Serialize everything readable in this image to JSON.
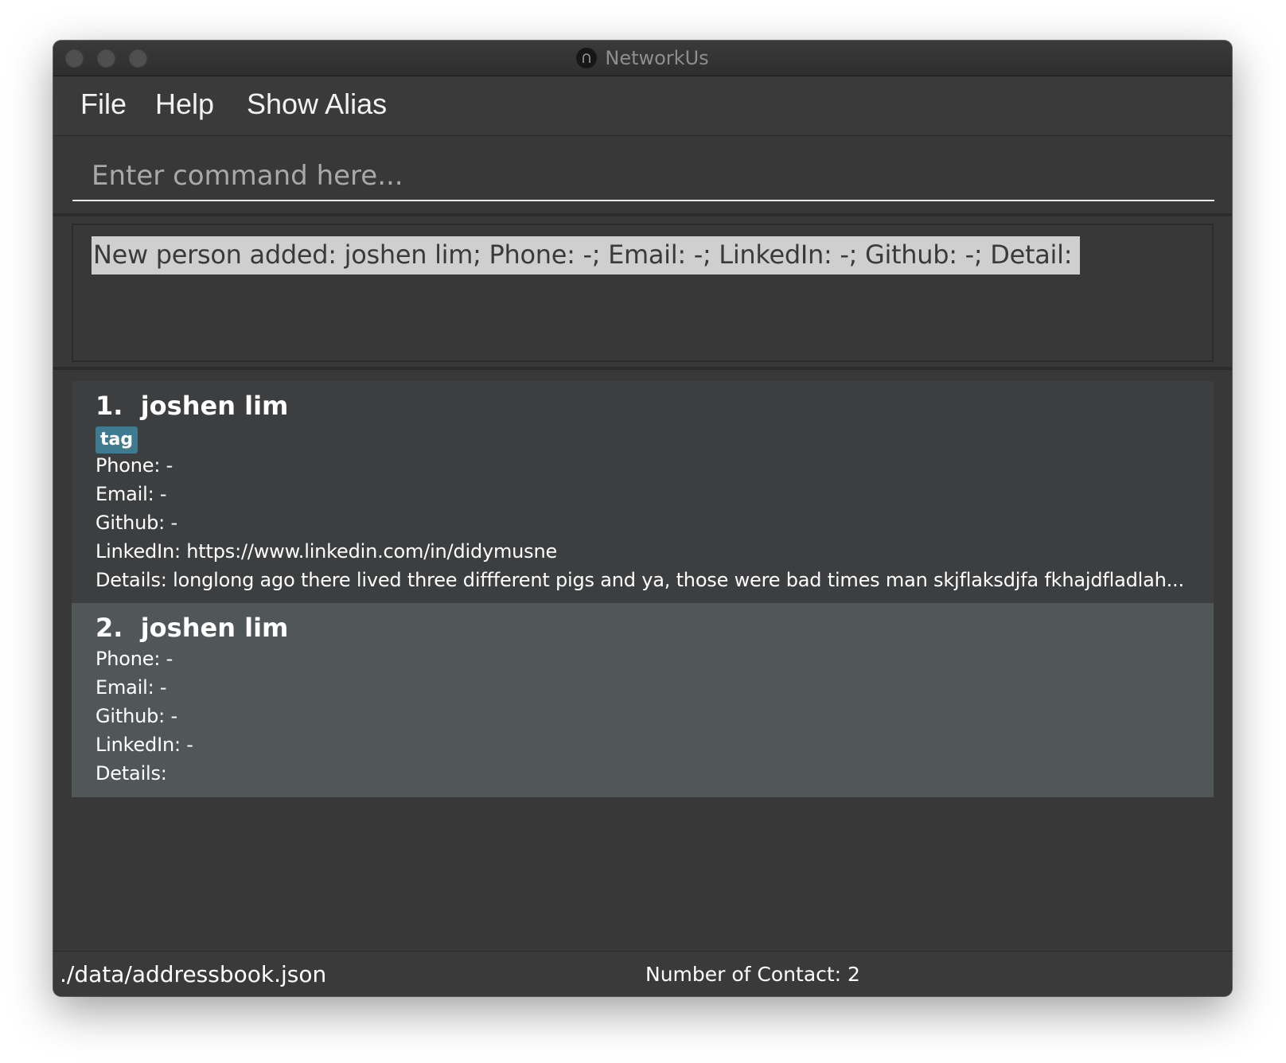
{
  "window": {
    "title": "NetworkUs"
  },
  "menu": {
    "file": "File",
    "help": "Help",
    "show_alias": "Show Alias"
  },
  "command": {
    "placeholder": "Enter command here...",
    "value": ""
  },
  "result": {
    "text": "New person added: joshen lim; Phone: -; Email: -; LinkedIn: -; Github: -; Detail:"
  },
  "persons": [
    {
      "index": "1.",
      "name": "joshen lim",
      "tags": [
        "tag"
      ],
      "phone": "Phone: -",
      "email": "Email: -",
      "github": "Github: -",
      "linkedin": "LinkedIn: https://www.linkedin.com/in/didymusne",
      "details": "Details: longlong ago there lived three diffferent pigs and ya, those were bad times man skjflaksdjfa fkhajdfladlah..."
    },
    {
      "index": "2.",
      "name": "joshen lim",
      "tags": [],
      "phone": "Phone: -",
      "email": "Email: -",
      "github": "Github: -",
      "linkedin": "LinkedIn: -",
      "details": "Details:"
    }
  ],
  "status": {
    "file_path": "./data/addressbook.json",
    "contact_count": "Number of Contact: 2"
  },
  "colors": {
    "window_bg": "#383838",
    "selected_card_bg": "#515658",
    "card_bg": "#3c3e3f",
    "tag_bg": "#3e7b91",
    "result_highlight": "#cfcfcf"
  }
}
